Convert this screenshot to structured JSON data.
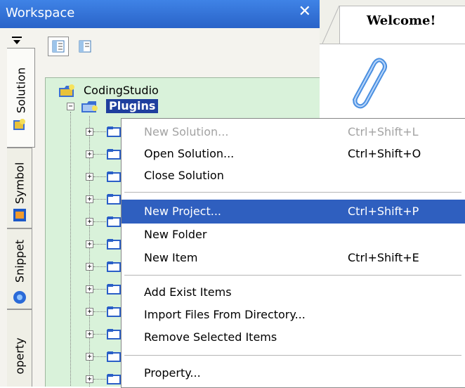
{
  "workspace": {
    "title": "Workspace",
    "close_glyph": "✕",
    "pin_glyph": "▾"
  },
  "side_tabs": [
    {
      "label": "Solution",
      "icon": "solution-icon"
    },
    {
      "label": "Symbol",
      "icon": "symbol-icon"
    },
    {
      "label": "Snippet",
      "icon": "snippet-icon"
    },
    {
      "label": "operty",
      "icon": ""
    }
  ],
  "toolbar": {
    "buttons": [
      "tree-view-icon",
      "list-view-icon"
    ]
  },
  "tree": {
    "root_label": "CodingStudio",
    "selected_label": "Plugins",
    "expander_plus": "+",
    "expander_minus": "−"
  },
  "editor": {
    "tab_label": "Welcome!",
    "tab_close": "✕"
  },
  "context_menu": {
    "items": [
      {
        "label": "New Solution...",
        "shortcut": "Ctrl+Shift+L",
        "disabled": true
      },
      {
        "label": "Open Solution...",
        "shortcut": "Ctrl+Shift+O"
      },
      {
        "label": "Close Solution",
        "shortcut": ""
      },
      {
        "label": "New Project...",
        "shortcut": "Ctrl+Shift+P",
        "highlighted": true
      },
      {
        "label": "New Folder",
        "shortcut": ""
      },
      {
        "label": "New Item",
        "shortcut": "Ctrl+Shift+E"
      },
      {
        "label": "Add Exist Items",
        "shortcut": ""
      },
      {
        "label": "Import Files From Directory...",
        "shortcut": ""
      },
      {
        "label": "Remove Selected Items",
        "shortcut": ""
      },
      {
        "label": "Property...",
        "shortcut": ""
      }
    ]
  },
  "colors": {
    "title_bar": "#2a63c8",
    "tree_bg": "#d9f2da",
    "selection": "#2f5fbf"
  }
}
